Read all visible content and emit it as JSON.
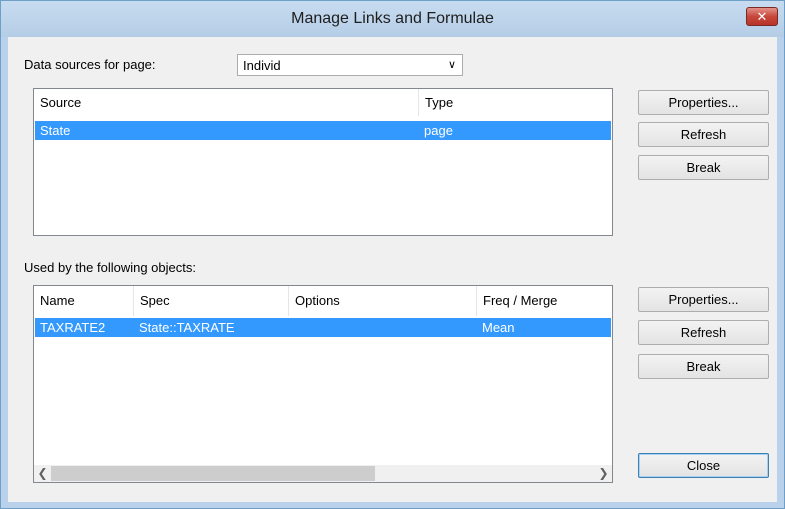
{
  "window": {
    "title": "Manage Links and Formulae",
    "close_glyph": "✕"
  },
  "sources": {
    "label": "Data sources for page:",
    "page_select": {
      "value": "Individ"
    },
    "columns": [
      "Source",
      "Type"
    ],
    "rows": [
      {
        "source": "State",
        "type": "page",
        "selected": true
      }
    ],
    "buttons": {
      "properties": "Properties...",
      "refresh": "Refresh",
      "break": "Break"
    }
  },
  "objects": {
    "label": "Used by the following objects:",
    "columns": [
      "Name",
      "Spec",
      "Options",
      "Freq / Merge"
    ],
    "rows": [
      {
        "name": "TAXRATE2",
        "spec": "State::TAXRATE",
        "options": "",
        "freq_merge": "Mean",
        "selected": true
      }
    ],
    "buttons": {
      "properties": "Properties...",
      "refresh": "Refresh",
      "break": "Break"
    }
  },
  "close_label": "Close",
  "icons": {
    "dropdown": "chevron-down-icon",
    "scroll_left": "chevron-left-icon",
    "scroll_right": "chevron-right-icon"
  }
}
